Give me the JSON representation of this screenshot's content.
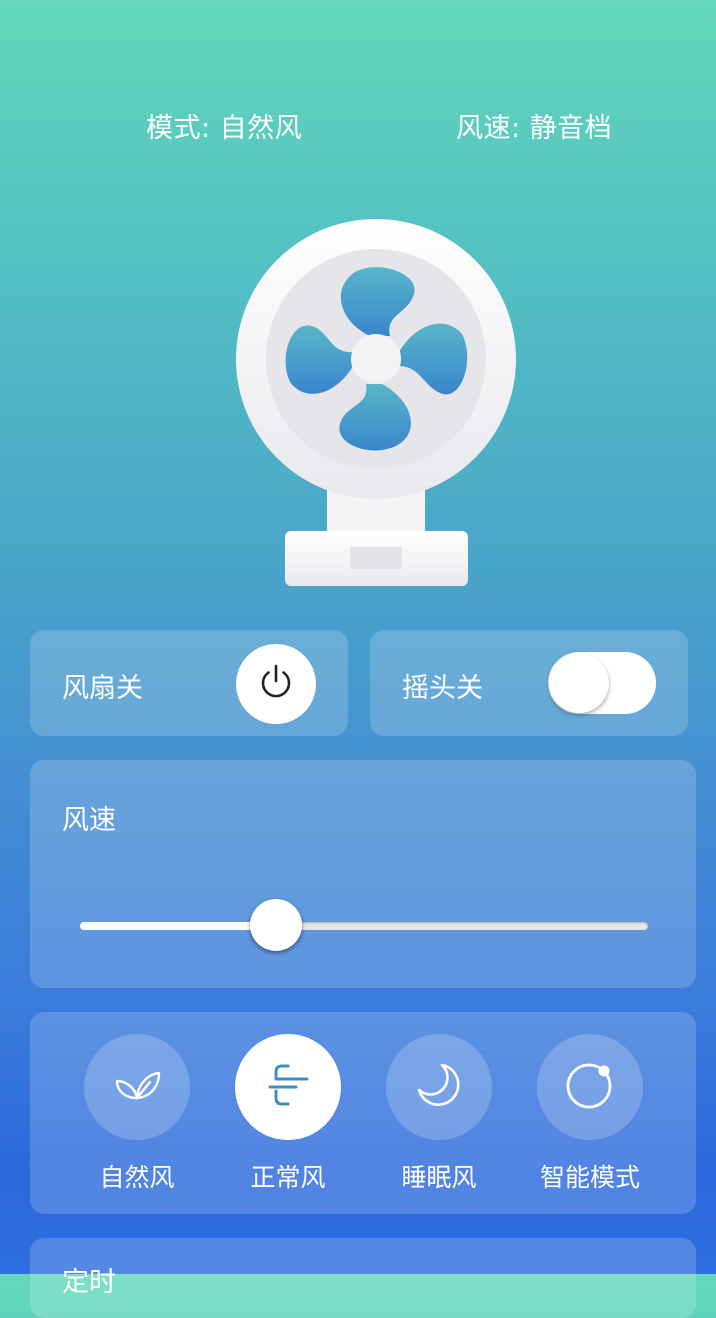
{
  "status": {
    "mode_text": "模式: 自然风",
    "speed_text": "风速: 静音档"
  },
  "power": {
    "label": "风扇关",
    "state": "off",
    "icon": "power-icon"
  },
  "swing": {
    "label": "摇头关",
    "state": "off"
  },
  "speed": {
    "label": "风速",
    "value_fraction": 0.345
  },
  "modes": {
    "items": [
      {
        "label": "自然风",
        "icon": "leaf-icon",
        "active": false
      },
      {
        "label": "正常风",
        "icon": "wind-icon",
        "active": true
      },
      {
        "label": "睡眠风",
        "icon": "moon-icon",
        "active": false
      },
      {
        "label": "智能模式",
        "icon": "smart-circle-icon",
        "active": false
      }
    ]
  },
  "timer": {
    "label": "定时"
  },
  "colors": {
    "accent_blue": "#3d8fc4",
    "gradient_top": "#62d8b9",
    "gradient_bottom": "#2b69dc"
  }
}
